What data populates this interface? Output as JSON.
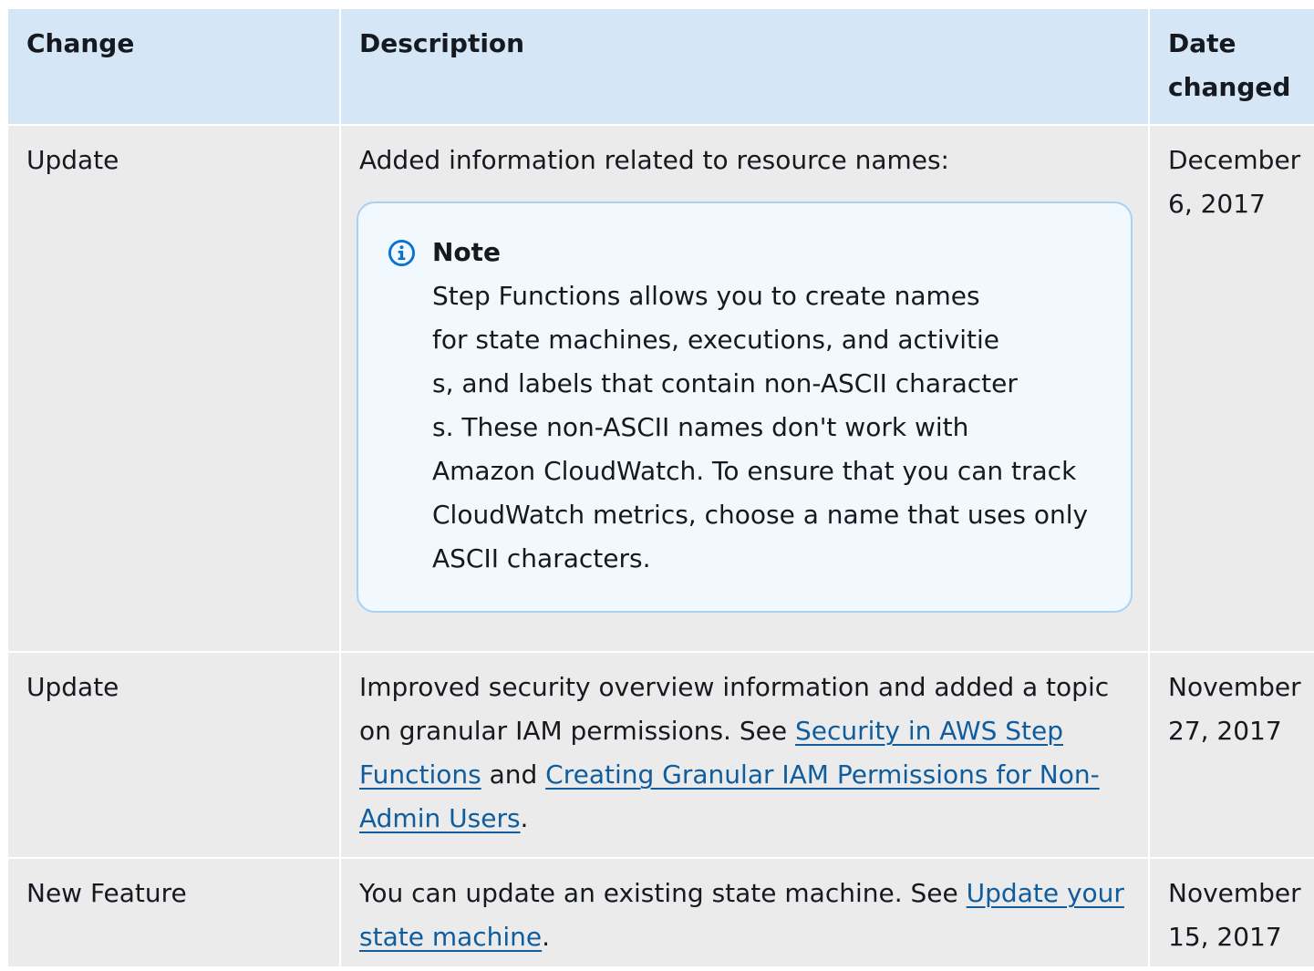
{
  "headers": {
    "change": "Change",
    "description": "Description",
    "date_line1": "Date",
    "date_line2": "changed"
  },
  "rows": [
    {
      "change": "Update",
      "description": "Added information related to resource names:",
      "note": {
        "title": "Note",
        "icon": "info-icon",
        "lines": [
          "Step Functions allows you to create names",
          "for state machines, executions, and activitie",
          "s, and labels that contain non-ASCII character",
          "s. These non-ASCII names don't work with",
          "Amazon CloudWatch. To ensure that you can track",
          "CloudWatch metrics, choose a name that uses only",
          "ASCII characters."
        ]
      },
      "date_line1": "December",
      "date_line2": "6, 2017"
    },
    {
      "change": "Update",
      "description_text1": "Improved security overview information and added a topic on granular IAM permissions. See ",
      "link1": "Security in AWS Step Functions",
      "description_text2": " and ",
      "link2": "Creating Granular IAM Permissions for Non-Admin Users",
      "description_text3": ".",
      "date_line1": "November",
      "date_line2": "27, 2017"
    },
    {
      "change": "New Feature",
      "description_text1": "You can update an existing state machine. See ",
      "link1": "Update your state machine",
      "description_text2": ".",
      "date_line1": "November",
      "date_line2": "15, 2017"
    }
  ],
  "colors": {
    "header_bg": "#d5e7f7",
    "row_bg": "#ebebeb",
    "note_bg": "#f1f8fe",
    "note_border": "#a9d1f1",
    "link": "#0f5c9e",
    "info_icon": "#0972d3"
  }
}
